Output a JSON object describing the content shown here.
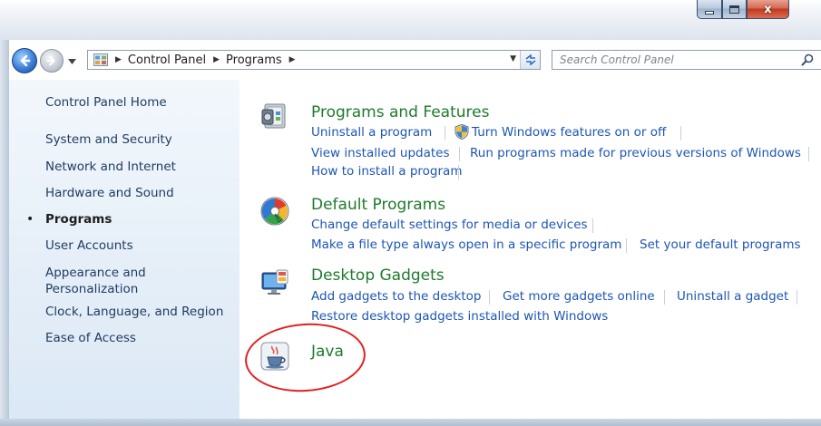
{
  "window": {
    "caption_buttons": {
      "minimize": "minimize",
      "maximize": "maximize",
      "close": "x"
    }
  },
  "navigation": {
    "breadcrumbs": [
      "Control Panel",
      "Programs"
    ],
    "search_placeholder": "Search Control Panel"
  },
  "sidebar": {
    "items": [
      {
        "label": "Control Panel Home"
      },
      {
        "label": "System and Security"
      },
      {
        "label": "Network and Internet"
      },
      {
        "label": "Hardware and Sound"
      },
      {
        "label": "Programs",
        "active": true
      },
      {
        "label": "User Accounts"
      },
      {
        "label": "Appearance and"
      },
      {
        "label": "Personalization"
      },
      {
        "label": "Clock, Language, and Region"
      },
      {
        "label": "Ease of Access"
      }
    ]
  },
  "categories": [
    {
      "title": "Programs and Features",
      "icon": "programs-features-icon",
      "links": [
        "Uninstall a program",
        "Turn Windows features on or off",
        "View installed updates",
        "Run programs made for previous versions of Windows",
        "How to install a program"
      ]
    },
    {
      "title": "Default Programs",
      "icon": "default-programs-icon",
      "links": [
        "Change default settings for media or devices",
        "Make a file type always open in a specific program",
        "Set your default programs"
      ]
    },
    {
      "title": "Desktop Gadgets",
      "icon": "desktop-gadgets-icon",
      "links": [
        "Add gadgets to the desktop",
        "Get more gadgets online",
        "Uninstall a gadget",
        "Restore desktop gadgets installed with Windows"
      ]
    },
    {
      "title": "Java",
      "icon": "java-icon",
      "links": []
    }
  ],
  "colors": {
    "link": "#1c56b5",
    "category_title": "#1f7a2c",
    "sidebar_text": "#1e3a5f",
    "annotation": "#e02020"
  }
}
